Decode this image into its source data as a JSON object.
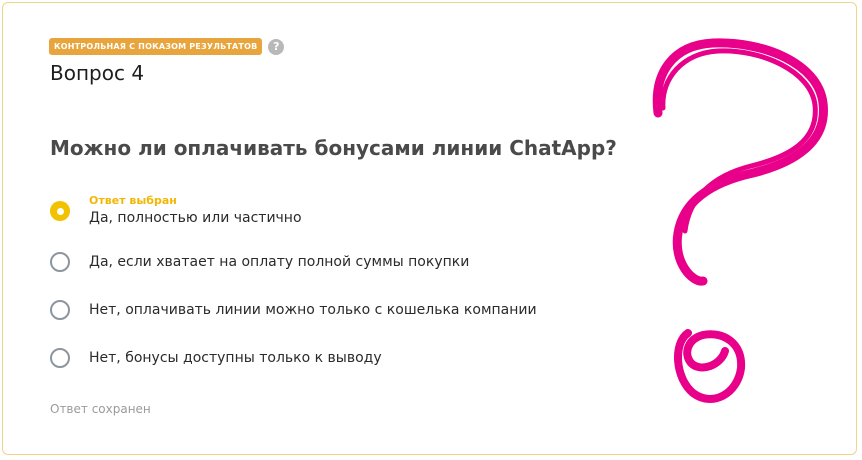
{
  "header": {
    "badge": "КОНТРОЛЬНАЯ С ПОКАЗОМ РЕЗУЛЬТАТОВ",
    "help_icon_glyph": "?",
    "question_number": "Вопрос 4"
  },
  "question": {
    "text": "Можно ли оплачивать бонусами линии ChatApp?"
  },
  "options": [
    {
      "label": "Да, полностью или частично",
      "selected": true,
      "status": "Ответ выбран"
    },
    {
      "label": "Да, если хватает на оплату полной суммы покупки",
      "selected": false
    },
    {
      "label": "Нет, оплачивать линии можно только с кошелька компании",
      "selected": false
    },
    {
      "label": "Нет, бонусы доступны только к выводу",
      "selected": false
    }
  ],
  "footer": {
    "saved_text": "Ответ сохранен"
  },
  "colors": {
    "badge_bg": "#e8a53d",
    "selected_radio": "#f2c100",
    "selected_label": "#f2b705",
    "doodle_stroke": "#e8008a",
    "card_border": "#f0d48a"
  },
  "icons": [
    "help-icon",
    "question-mark-doodle-icon"
  ]
}
